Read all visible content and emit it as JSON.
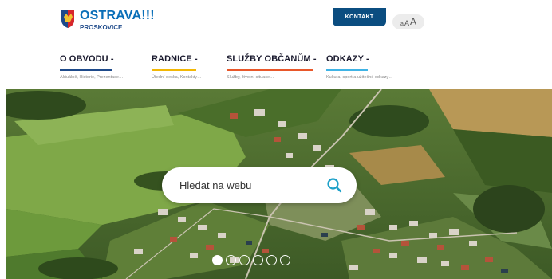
{
  "header": {
    "logo": {
      "title": "OSTRAVA!!!",
      "subtitle": "PROSKOVICE"
    },
    "kontakt_label": "KONTAKT",
    "font_size": {
      "small": "a",
      "mid": "A",
      "big": "A"
    }
  },
  "nav": [
    {
      "label": "O OBVODU",
      "sub": "Aktuálně, Historie, Prezentace…",
      "color": "#1e4a8a"
    },
    {
      "label": "RADNICE",
      "sub": "Úřední deska, Kontakty…",
      "color": "#f2b705"
    },
    {
      "label": "SLUŽBY OBČANŮM",
      "sub": "Služby, životní situace…",
      "color": "#e8572a"
    },
    {
      "label": "ODKAZY",
      "sub": "Kultura, sport a užitečné odkazy…",
      "color": "#3fb3e5"
    }
  ],
  "search": {
    "placeholder": "Hledat na webu"
  },
  "carousel": {
    "slide_count": 6,
    "active_index": 0
  },
  "colors": {
    "brand_blue": "#0a6fb8",
    "kontakt_bg": "#0b4d80",
    "search_icon": "#1ea1c9"
  },
  "icons": {
    "search": "search-icon",
    "logo": "coat-of-arms-icon"
  }
}
